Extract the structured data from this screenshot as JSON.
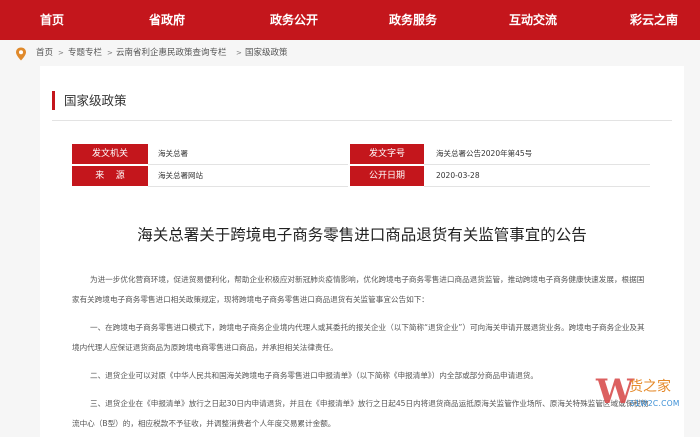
{
  "nav": {
    "items": [
      "首页",
      "省政府",
      "政务公开",
      "政务服务",
      "互动交流",
      "彩云之南"
    ]
  },
  "breadcrumb": {
    "items": [
      "首页",
      "专题专栏",
      "云南省利企惠民政策查询专栏",
      "国家级政策"
    ],
    "separator": ">"
  },
  "section": {
    "title": "国家级政策"
  },
  "meta": {
    "issuer_label": "发文机关",
    "issuer_value": "海关总署",
    "doc_no_label": "发文字号",
    "doc_no_value": "海关总署公告2020年第45号",
    "source_label": "来    源",
    "source_value": "海关总署网站",
    "date_label": "公开日期",
    "date_value": "2020-03-28"
  },
  "document": {
    "title": "海关总署关于跨境电子商务零售进口商品退货有关监管事宜的公告",
    "paragraphs": [
      "为进一步优化营商环境，促进贸易便利化，帮助企业积极应对新冠肺炎疫情影响，优化跨境电子商务零售进口商品退货监管，推动跨境电子商务健康快速发展，根据国家有关跨境电子商务零售进口相关政策规定，现将跨境电子商务零售进口商品退货有关监管事宜公告如下：",
      "一、在跨境电子商务零售进口模式下，跨境电子商务企业境内代理人或其委托的报关企业（以下简称“退货企业”）可向海关申请开展退货业务。跨境电子商务企业及其境内代理人应保证退货商品为原跨境电商零售进口商品，并承担相关法律责任。",
      "二、退货企业可以对原《中华人民共和国海关跨境电子商务零售进口申报清单》（以下简称《申报清单》）内全部或部分商品申请退货。",
      "三、退货企业在《申报清单》放行之日起30日内申请退货，并且在《申报清单》放行之日起45日内将退货商品运抵原海关监管作业场所、原海关特殊监管区域或保税物流中心（B型）的，相应税款不予征收，并调整消费者个人年度交易累计金额。"
    ]
  },
  "watermark": {
    "name": "货之家",
    "url": "51W2C.COM"
  },
  "colors": {
    "brand_red": "#c4161c",
    "page_bg": "#f6f6f6"
  }
}
